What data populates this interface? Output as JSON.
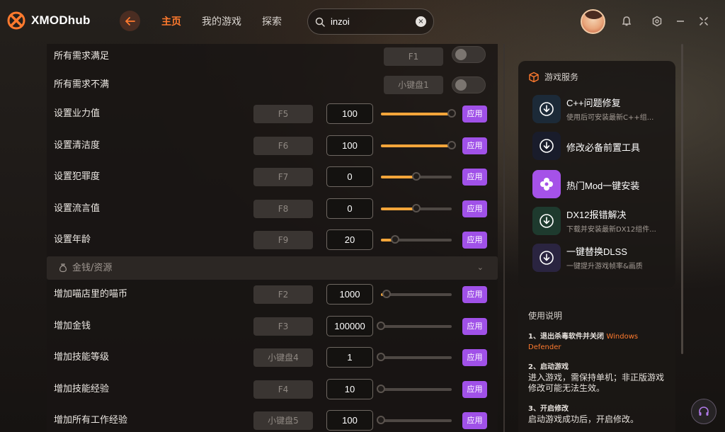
{
  "app": {
    "logo_text": "XMODhub"
  },
  "nav": {
    "home": "主页",
    "my_games": "我的游戏",
    "explore": "探索"
  },
  "search": {
    "value": "inzoi",
    "clear": "×"
  },
  "colors": {
    "accent": "#ff7a2e",
    "apply": "#a051e8",
    "slider_fill": "#f3a53a"
  },
  "icons": {
    "back": "arrow-left-icon",
    "search": "search-icon",
    "notify": "bell-icon",
    "settings": "hexagon-gear-icon",
    "minimize": "minimize-icon",
    "close": "close-icon",
    "support": "headset-icon"
  },
  "toggles": [
    {
      "label": "所有需求满足",
      "hotkey": "F1",
      "on": false
    },
    {
      "label": "所有需求不满",
      "hotkey": "小键盘1",
      "on": false
    }
  ],
  "apply_label": "应用",
  "sliders_top": [
    {
      "label": "设置业力值",
      "hotkey": "F5",
      "value": "100",
      "level": 1.0
    },
    {
      "label": "设置清洁度",
      "hotkey": "F6",
      "value": "100",
      "level": 1.0
    },
    {
      "label": "设置犯罪度",
      "hotkey": "F7",
      "value": "0",
      "level": 0.5
    },
    {
      "label": "设置流言值",
      "hotkey": "F8",
      "value": "0",
      "level": 0.5
    },
    {
      "label": "设置年龄",
      "hotkey": "F9",
      "value": "20",
      "level": 0.2
    }
  ],
  "section": {
    "title": "金钱/资源",
    "chevron": "⌄"
  },
  "sliders_money": [
    {
      "label": "增加喵店里的喵币",
      "hotkey": "F2",
      "value": "1000",
      "level": 0.08
    },
    {
      "label": "增加金钱",
      "hotkey": "F3",
      "value": "100000",
      "level": 0.0
    },
    {
      "label": "增加技能等级",
      "hotkey": "小键盘4",
      "value": "1",
      "level": 0.0
    },
    {
      "label": "增加技能经验",
      "hotkey": "F4",
      "value": "10",
      "level": 0.0
    },
    {
      "label": "增加所有工作经验",
      "hotkey": "小键盘5",
      "value": "100",
      "level": 0.0
    }
  ],
  "services": {
    "title": "游戏服务",
    "items": [
      {
        "name": "C++问题修复",
        "desc": "使用后可安装最新C++组...",
        "icon": "download-icon"
      },
      {
        "name": "修改必备前置工具",
        "desc": "",
        "icon": "download-icon"
      },
      {
        "name": "热门Mod一键安装",
        "desc": "",
        "icon": "flower-icon"
      },
      {
        "name": "DX12报错解决",
        "desc": "下载并安装最新DX12组件...",
        "icon": "download-icon"
      },
      {
        "name": "一键替换DLSS",
        "desc": "一键提升游戏帧率&画质",
        "icon": "download-icon"
      }
    ]
  },
  "instructions": {
    "title": "使用说明",
    "step1_head": "1、退出杀毒软件并关闭",
    "step1_highlight": "Windows Defender",
    "step2_head": "2、启动游戏",
    "step2_body": "进入游戏，需保持单机；非正版游戏修改可能无法生效。",
    "step3_head": "3、开启修改",
    "step3_body": "启动游戏成功后，开启修改。"
  }
}
